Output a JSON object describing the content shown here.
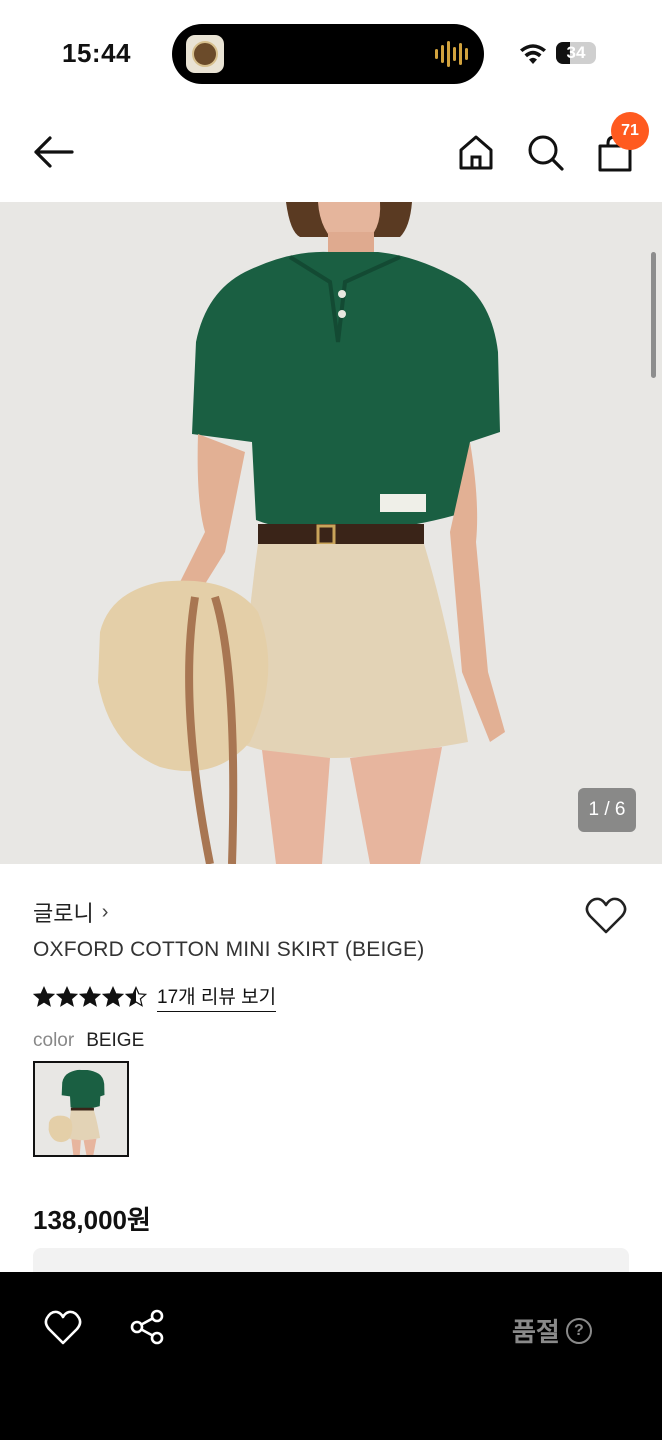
{
  "status_bar": {
    "time": "15:44",
    "battery_level": "34",
    "battery_fraction": 0.34
  },
  "header": {
    "cart_count": "71",
    "icons": [
      "back-arrow-icon",
      "home-icon",
      "search-icon",
      "shopping-bag-icon"
    ]
  },
  "gallery": {
    "counter": "1 / 6",
    "current": 1,
    "total": 6
  },
  "product": {
    "brand": "글로니",
    "brand_chevron": "›",
    "title": "OXFORD COTTON MINI SKIRT (BEIGE)",
    "rating": 4.5,
    "review_link": "17개 리뷰 보기",
    "color_label": "color",
    "color_value": "BEIGE",
    "price": "138,000원"
  },
  "bottom_bar": {
    "status_label": "품절",
    "help_glyph": "?"
  },
  "colors": {
    "badge": "#ff5a1f",
    "bottom_bar_bg": "#000000",
    "disabled_text": "#8a8a8a"
  }
}
